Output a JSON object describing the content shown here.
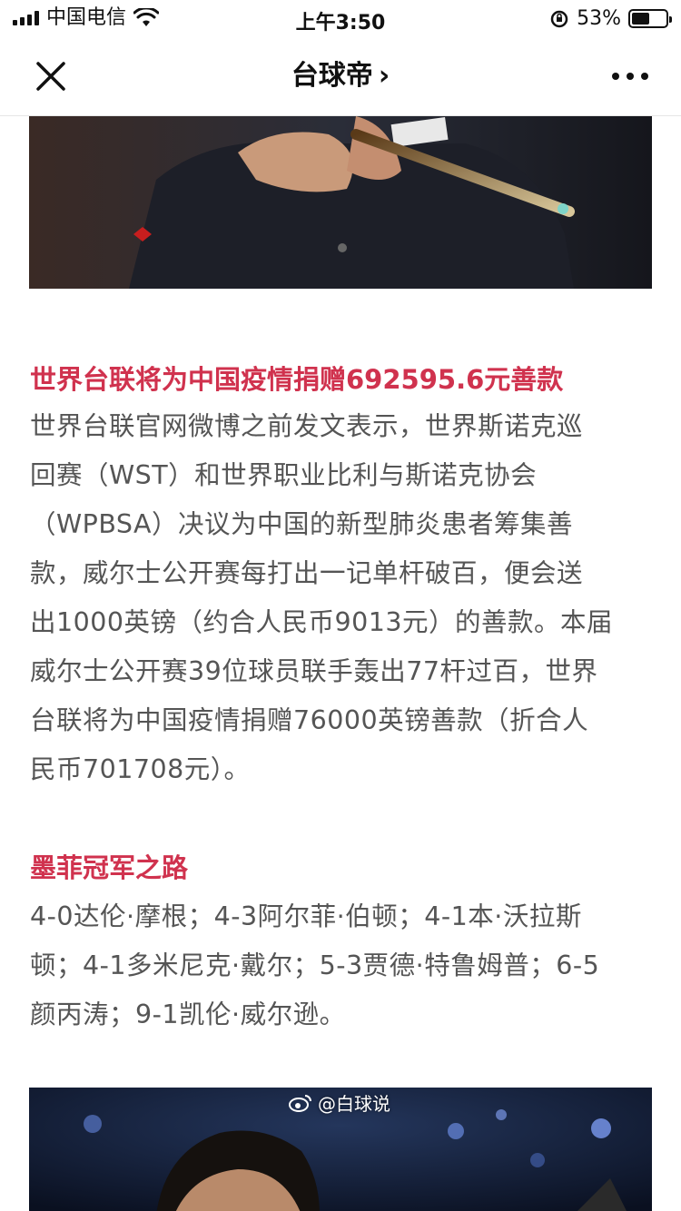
{
  "status_bar": {
    "carrier": "中国电信",
    "time": "上午3:50",
    "battery_percent": "53%",
    "battery_level": 0.53
  },
  "nav": {
    "title": "台球帝",
    "chevron": "›"
  },
  "article": {
    "section1": {
      "heading": "世界台联将为中国疫情捐赠692595.6元善款",
      "lines": [
        "世界台联官网微博之前发文表示，世界斯诺克巡",
        "回赛（WST）和世界职业比利与斯诺克协会",
        "（WPBSA）决议为中国的新型肺炎患者筹集善",
        "款，威尔士公开赛每打出一记单杆破百，便会送",
        "出1000英镑（约合人民币9013元）的善款。本届",
        "威尔士公开赛39位球员联手轰出77杆过百，世界",
        "台联将为中国疫情捐赠76000英镑善款（折合人",
        "民币701708元）。"
      ]
    },
    "section2": {
      "heading": "墨菲冠军之路",
      "lines": [
        "4-0达伦·摩根；4-3阿尔菲·伯顿；4-1本·沃拉斯",
        "顿；4-1多米尼克·戴尔；5-3贾德·特鲁姆普；6-5",
        "颜丙涛；9-1凯伦·威尔逊。"
      ]
    },
    "watermark": "@白球说"
  },
  "colors": {
    "heading": "#d0324e",
    "body_text": "#555555"
  },
  "icons": {
    "close": "close-icon",
    "more": "more-icon",
    "weibo": "weibo-icon"
  }
}
